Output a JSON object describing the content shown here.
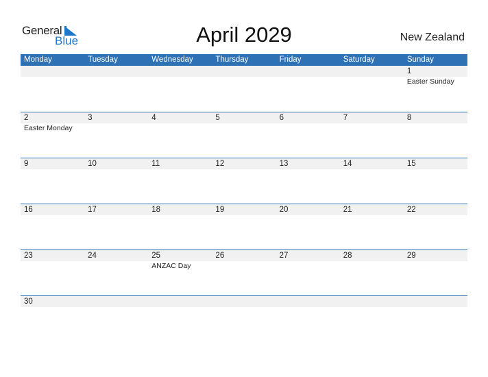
{
  "logo": {
    "line1": "General",
    "line2": "Blue"
  },
  "title": "April 2029",
  "country": "New Zealand",
  "colors": {
    "accent": "#2e72b5",
    "logo_blue": "#1f77c9",
    "row_band": "#f1f1f1"
  },
  "weekdays": [
    "Monday",
    "Tuesday",
    "Wednesday",
    "Thursday",
    "Friday",
    "Saturday",
    "Sunday"
  ],
  "weeks": [
    [
      {
        "d": "",
        "h": ""
      },
      {
        "d": "",
        "h": ""
      },
      {
        "d": "",
        "h": ""
      },
      {
        "d": "",
        "h": ""
      },
      {
        "d": "",
        "h": ""
      },
      {
        "d": "",
        "h": ""
      },
      {
        "d": "1",
        "h": "Easter Sunday"
      }
    ],
    [
      {
        "d": "2",
        "h": "Easter Monday"
      },
      {
        "d": "3",
        "h": ""
      },
      {
        "d": "4",
        "h": ""
      },
      {
        "d": "5",
        "h": ""
      },
      {
        "d": "6",
        "h": ""
      },
      {
        "d": "7",
        "h": ""
      },
      {
        "d": "8",
        "h": ""
      }
    ],
    [
      {
        "d": "9",
        "h": ""
      },
      {
        "d": "10",
        "h": ""
      },
      {
        "d": "11",
        "h": ""
      },
      {
        "d": "12",
        "h": ""
      },
      {
        "d": "13",
        "h": ""
      },
      {
        "d": "14",
        "h": ""
      },
      {
        "d": "15",
        "h": ""
      }
    ],
    [
      {
        "d": "16",
        "h": ""
      },
      {
        "d": "17",
        "h": ""
      },
      {
        "d": "18",
        "h": ""
      },
      {
        "d": "19",
        "h": ""
      },
      {
        "d": "20",
        "h": ""
      },
      {
        "d": "21",
        "h": ""
      },
      {
        "d": "22",
        "h": ""
      }
    ],
    [
      {
        "d": "23",
        "h": ""
      },
      {
        "d": "24",
        "h": ""
      },
      {
        "d": "25",
        "h": "ANZAC Day"
      },
      {
        "d": "26",
        "h": ""
      },
      {
        "d": "27",
        "h": ""
      },
      {
        "d": "28",
        "h": ""
      },
      {
        "d": "29",
        "h": ""
      }
    ],
    [
      {
        "d": "30",
        "h": ""
      },
      {
        "d": "",
        "h": ""
      },
      {
        "d": "",
        "h": ""
      },
      {
        "d": "",
        "h": ""
      },
      {
        "d": "",
        "h": ""
      },
      {
        "d": "",
        "h": ""
      },
      {
        "d": "",
        "h": ""
      }
    ]
  ]
}
